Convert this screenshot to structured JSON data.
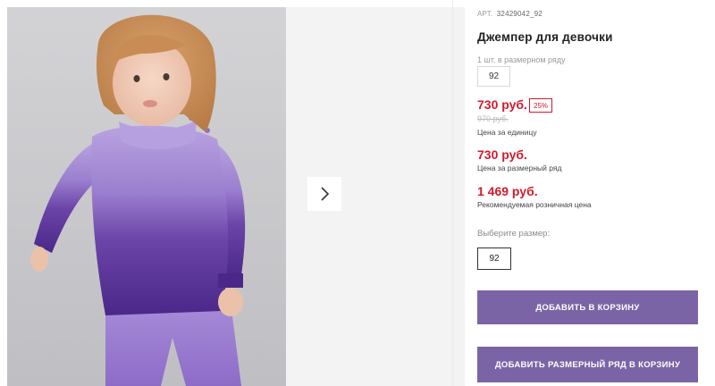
{
  "product": {
    "image_alt": "Девочка в джемпере",
    "sku_label": "АРТ.",
    "sku_value": "32429042_92",
    "title": "Джемпер для девочки",
    "size_row_note": "1 шт. в размерном ряду",
    "size_row_value": "92"
  },
  "pricing": {
    "current": "730 руб.",
    "discount": "25%",
    "old": "970 руб.",
    "unit_note": "Цена за единицу",
    "row_price": "730 руб.",
    "row_note": "Цена за размерный ряд",
    "retail_price": "1 469 руб.",
    "retail_note": "Рекомендуемая розничная цена"
  },
  "size_picker": {
    "label": "Выберите размер:",
    "selected": "92"
  },
  "actions": {
    "add_to_cart": "Добавить в корзину",
    "add_row_to_cart": "Добавить размерный ряд в корзину"
  },
  "colors": {
    "accent": "#7b64a6",
    "price": "#d41a2d"
  },
  "icons": {
    "next": "chevron-right-icon"
  }
}
